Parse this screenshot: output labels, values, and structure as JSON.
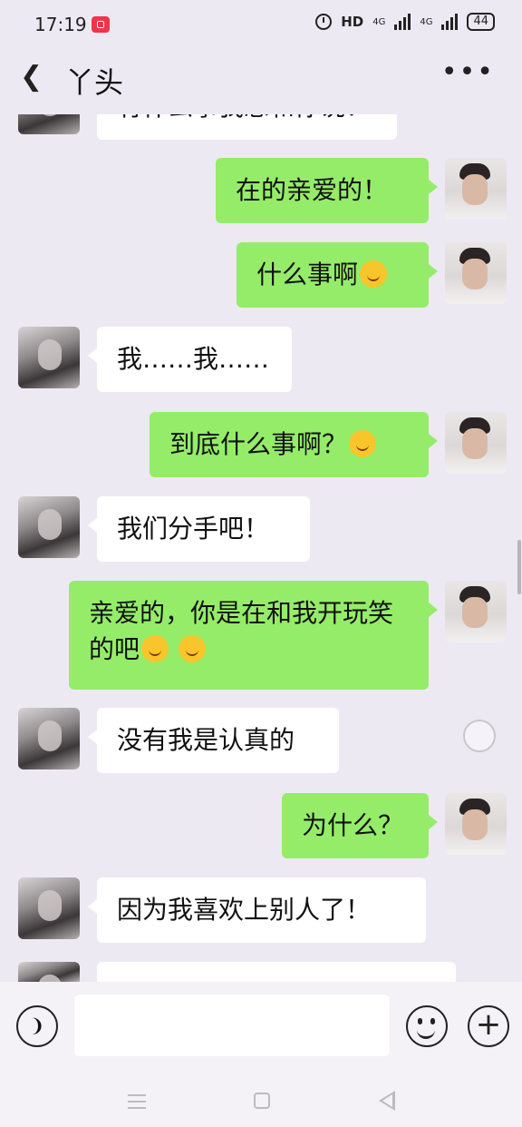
{
  "status_bar": {
    "time": "17:19",
    "network_left": "4G",
    "network_right": "4G",
    "hd": "HD",
    "battery": "44"
  },
  "header": {
    "title": "丫头"
  },
  "messages": [
    {
      "side": "in",
      "text": "有什么事我想和你说！"
    },
    {
      "side": "out",
      "text": "在的亲爱的！"
    },
    {
      "side": "out",
      "text": "什么事啊",
      "emoji": "smiling-face"
    },
    {
      "side": "in",
      "text": "我……我……"
    },
    {
      "side": "out",
      "text": "到底什么事啊？",
      "emoji": "tongue-wink-face"
    },
    {
      "side": "in",
      "text": "我们分手吧！"
    },
    {
      "side": "out",
      "text": "亲爱的，你是在和我开玩笑的吧",
      "emoji": "grinning-face x2"
    },
    {
      "side": "in",
      "text": "没有我是认真的"
    },
    {
      "side": "out",
      "text": "为什么？"
    },
    {
      "side": "in",
      "text": "因为我喜欢上别人了！"
    },
    {
      "side": "in",
      "text": ""
    }
  ],
  "input": {
    "placeholder": ""
  },
  "colors": {
    "outgoing_bubble": "#95ec69",
    "incoming_bubble": "#ffffff",
    "background": "#ede9f2",
    "record_indicator": "#f0354a"
  }
}
